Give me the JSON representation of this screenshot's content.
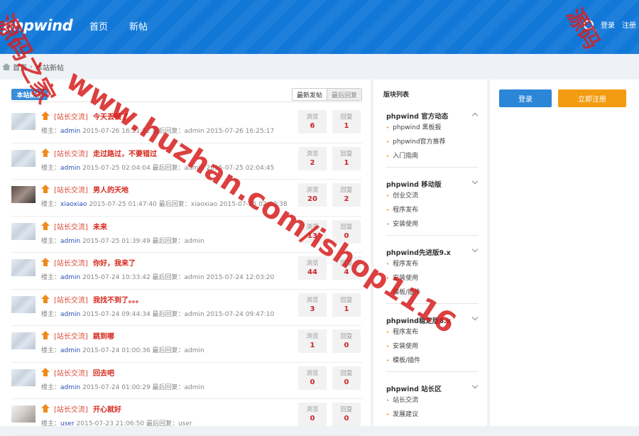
{
  "header": {
    "logo": "phpwind",
    "nav": [
      "首页",
      "新帖"
    ],
    "right_links": [
      "登录",
      "注册"
    ]
  },
  "breadcrumb": {
    "home": "首页",
    "current": "本站新帖"
  },
  "main": {
    "tab_label": "本站新帖",
    "sort": {
      "latest_post": "最新发帖",
      "latest_reply": "最后回复"
    },
    "view_label": "浏览",
    "reply_label": "回复",
    "posts": [
      {
        "cat": "[站长交流]",
        "title": "今天丢钱了",
        "meta": "楼主：",
        "user": "admin",
        "info": "2015-07-26 16:21:22    最后回复：admin  2015-07-26 16:25:17",
        "views": "6",
        "replies": "1"
      },
      {
        "cat": "[站长交流]",
        "title": "走过路过，不要错过",
        "meta": "楼主：",
        "user": "admin",
        "info": "2015-07-25 02:04:04    最后回复：admin  2015-07-25 02:04:45",
        "views": "2",
        "replies": "1"
      },
      {
        "cat": "[站长交流]",
        "title": "男人的天地",
        "meta": "楼主：",
        "user": "xiaoxiao",
        "info": "2015-07-25 01:47:40    最后回复：xiaoxiao  2015-07-25 02:00:38",
        "views": "20",
        "replies": "2"
      },
      {
        "cat": "[站长交流]",
        "title": "未来",
        "meta": "楼主：",
        "user": "admin",
        "info": "2015-07-25 01:39:49    最后回复：admin",
        "views": "13",
        "replies": "0"
      },
      {
        "cat": "[站长交流]",
        "title": "你好，我来了",
        "meta": "楼主：",
        "user": "admin",
        "info": "2015-07-24 10:33:42    最后回复：admin  2015-07-24 12:03:20",
        "views": "44",
        "replies": "4"
      },
      {
        "cat": "[站长交流]",
        "title": "我找不到了。。。",
        "meta": "楼主：",
        "user": "admin",
        "info": "2015-07-24 09:44:34    最后回复：admin  2015-07-24 09:47:10",
        "views": "3",
        "replies": "1"
      },
      {
        "cat": "[站长交流]",
        "title": "跳到哪",
        "meta": "楼主：",
        "user": "admin",
        "info": "2015-07-24 01:00:36    最后回复：admin",
        "views": "1",
        "replies": "0"
      },
      {
        "cat": "[站长交流]",
        "title": "回去吧",
        "meta": "楼主：",
        "user": "admin",
        "info": "2015-07-24 01:00:29    最后回复：admin",
        "views": "0",
        "replies": "0"
      },
      {
        "cat": "[站长交流]",
        "title": "开心就好",
        "meta": "楼主：",
        "user": "user",
        "info": "2015-07-23 21:06:50    最后回复：user",
        "views": "0",
        "replies": "0"
      }
    ]
  },
  "sidebar": {
    "title": "版块列表",
    "groups": [
      {
        "name": "phpwind 官方动态",
        "items": [
          "phpwind 黑板报",
          "phpwind官方推荐",
          "入门指南"
        ]
      },
      {
        "name": "phpwind 移动版",
        "items": [
          "创业交流",
          "程序发布",
          "安装使用"
        ]
      },
      {
        "name": "phpwind先进版9.x",
        "items": [
          "程序发布",
          "安装使用",
          "模板/插件"
        ]
      },
      {
        "name": "phpwind稳定版8.x",
        "items": [
          "程序发布",
          "安装使用",
          "模板/插件"
        ]
      },
      {
        "name": "phpwind 站长区",
        "items": [
          "站长交流",
          "发展建议"
        ]
      }
    ]
  },
  "account": {
    "login": "登录",
    "register": "立即注册"
  },
  "watermark": {
    "left": "源码之家",
    "center": "www.huzhan.com/ishop1116",
    "right": "源码"
  },
  "colors": {
    "header_blue": "#1278d8",
    "title_red": "#d4271c",
    "register_orange": "#f39c12",
    "login_blue": "#2c86d8"
  }
}
